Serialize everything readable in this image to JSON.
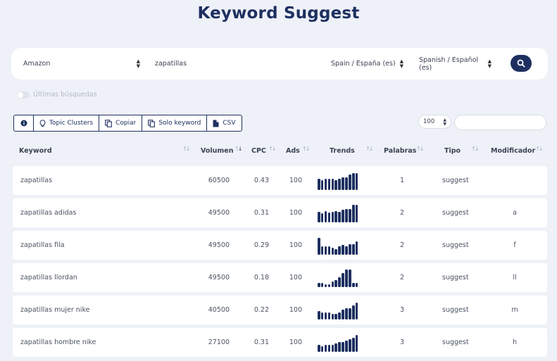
{
  "page": {
    "title": "Keyword Suggest"
  },
  "search": {
    "source": "Amazon",
    "query": "zapatillas",
    "country": "Spain / España (es)",
    "language": "Spanish / Español (es)"
  },
  "history_toggle": {
    "label": "Últimas búsquedas",
    "on": false
  },
  "toolbar": {
    "topic_clusters": "Topic Clusters",
    "copy": "Copiar",
    "solo_keyword": "Solo keyword",
    "csv": "CSV"
  },
  "table_controls": {
    "page_size": "100",
    "filter_placeholder": ""
  },
  "columns": {
    "keyword": "Keyword",
    "volume": "Volumen",
    "cpc": "CPC",
    "ads": "Ads",
    "trends": "Trends",
    "words": "Palabras",
    "type": "Tipo",
    "modifier": "Modificador"
  },
  "colors": {
    "accent": "#1e3060",
    "background": "#eef1f8"
  },
  "rows": [
    {
      "keyword": "zapatillas",
      "volume": "60500",
      "cpc": "0.43",
      "ads": "100",
      "words": "1",
      "type": "suggest",
      "modifier": "",
      "trend": [
        0.62,
        0.55,
        0.62,
        0.62,
        0.62,
        0.55,
        0.62,
        0.69,
        0.69,
        0.85,
        0.92,
        0.92
      ]
    },
    {
      "keyword": "zapatillas adidas",
      "volume": "49500",
      "cpc": "0.31",
      "ads": "100",
      "words": "2",
      "type": "suggest",
      "modifier": "a",
      "trend": [
        0.58,
        0.5,
        0.62,
        0.54,
        0.58,
        0.62,
        0.58,
        0.69,
        0.73,
        0.73,
        0.96,
        0.96
      ]
    },
    {
      "keyword": "zapatillas fila",
      "volume": "49500",
      "cpc": "0.29",
      "ads": "100",
      "words": "2",
      "type": "suggest",
      "modifier": "f",
      "trend": [
        0.92,
        0.46,
        0.46,
        0.46,
        0.38,
        0.31,
        0.46,
        0.54,
        0.46,
        0.58,
        0.58,
        0.73
      ]
    },
    {
      "keyword": "zapatillas llordan",
      "volume": "49500",
      "cpc": "0.18",
      "ads": "100",
      "words": "2",
      "type": "suggest",
      "modifier": "ll",
      "trend": [
        0.23,
        0.23,
        0.15,
        0.15,
        0.31,
        0.38,
        0.54,
        0.77,
        0.96,
        0.96,
        0.23,
        0.23
      ]
    },
    {
      "keyword": "zapatillas mujer nike",
      "volume": "40500",
      "cpc": "0.22",
      "ads": "100",
      "words": "3",
      "type": "suggest",
      "modifier": "m",
      "trend": [
        0.46,
        0.38,
        0.38,
        0.38,
        0.31,
        0.31,
        0.38,
        0.54,
        0.62,
        0.62,
        0.77,
        0.92
      ]
    },
    {
      "keyword": "zapatillas hombre nike",
      "volume": "27100",
      "cpc": "0.31",
      "ads": "100",
      "words": "3",
      "type": "suggest",
      "modifier": "h",
      "trend": [
        0.38,
        0.31,
        0.38,
        0.38,
        0.38,
        0.46,
        0.54,
        0.54,
        0.62,
        0.69,
        0.77,
        0.92
      ]
    }
  ]
}
